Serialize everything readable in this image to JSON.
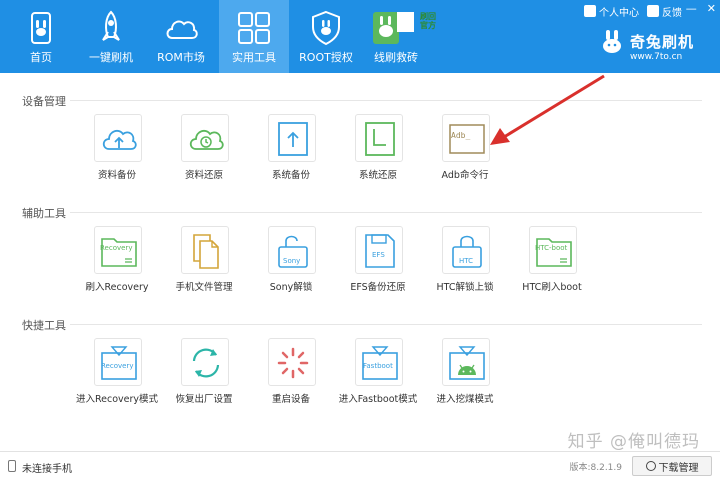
{
  "nav": {
    "items": [
      {
        "label": "首页",
        "icon": "rabbit-phone-icon"
      },
      {
        "label": "一键刷机",
        "icon": "rocket-icon"
      },
      {
        "label": "ROM市场",
        "icon": "cloud-icon"
      },
      {
        "label": "实用工具",
        "icon": "grid-icon",
        "active": true
      },
      {
        "label": "ROOT授权",
        "icon": "shield-icon"
      },
      {
        "label": "线刷救砖",
        "icon": "rabbit-badge-icon",
        "badge": "刷回官方"
      }
    ]
  },
  "top_links": {
    "user_center": "个人中心",
    "feedback": "反馈",
    "minimize": "—",
    "close": "✕"
  },
  "brand": {
    "name": "奇兔刷机",
    "site": "www.7to.cn"
  },
  "sections": [
    {
      "title": "设备管理",
      "tools": [
        {
          "label": "资料备份",
          "icon": "cloud-upload-icon"
        },
        {
          "label": "资料还原",
          "icon": "clock-restore-icon"
        },
        {
          "label": "系统备份",
          "icon": "upload-box-icon"
        },
        {
          "label": "系统还原",
          "icon": "restore-box-icon"
        },
        {
          "label": "Adb命令行",
          "icon": "terminal-icon",
          "tile_text": "Adb_"
        }
      ]
    },
    {
      "title": "辅助工具",
      "tools": [
        {
          "label": "刷入Recovery",
          "icon": "recovery-folder-icon",
          "tile_text": "Recovery"
        },
        {
          "label": "手机文件管理",
          "icon": "documents-icon"
        },
        {
          "label": "Sony解锁",
          "icon": "unlock-icon",
          "tile_text": "Sony"
        },
        {
          "label": "EFS备份还原",
          "icon": "sd-card-icon",
          "tile_text": "EFS"
        },
        {
          "label": "HTC解锁上锁",
          "icon": "lock-icon",
          "tile_text": "HTC"
        },
        {
          "label": "HTC刷入boot",
          "icon": "boot-folder-icon",
          "tile_text": "HTC-boot"
        }
      ]
    },
    {
      "title": "快捷工具",
      "tools": [
        {
          "label": "进入Recovery模式",
          "icon": "recovery-mode-icon",
          "tile_text": "Recovery"
        },
        {
          "label": "恢复出厂设置",
          "icon": "factory-reset-icon"
        },
        {
          "label": "重启设备",
          "icon": "reboot-spinner-icon"
        },
        {
          "label": "进入Fastboot模式",
          "icon": "fastboot-mode-icon",
          "tile_text": "Fastboot"
        },
        {
          "label": "进入挖煤模式",
          "icon": "android-mining-icon"
        }
      ]
    }
  ],
  "status": {
    "connection": "未连接手机",
    "version": "版本:8.2.1.9",
    "download_button": "下载管理"
  },
  "watermark": "知乎 @俺叫德玛",
  "colors": {
    "header": "#1f8fe4",
    "active_tab": "#4da9ee",
    "blue_icon": "#3aa0df",
    "green_icon": "#5cb85c",
    "brown_icon": "#a08b5a",
    "red_icon": "#e06666",
    "arrow": "#d9302c"
  }
}
